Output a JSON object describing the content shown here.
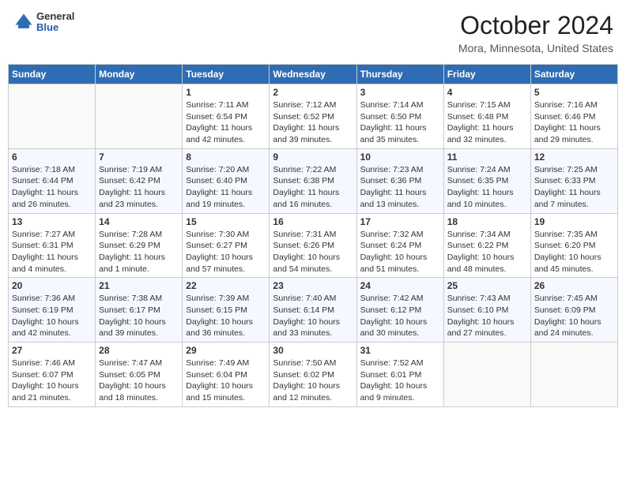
{
  "header": {
    "logo_general": "General",
    "logo_blue": "Blue",
    "month_title": "October 2024",
    "location": "Mora, Minnesota, United States"
  },
  "days_of_week": [
    "Sunday",
    "Monday",
    "Tuesday",
    "Wednesday",
    "Thursday",
    "Friday",
    "Saturday"
  ],
  "weeks": [
    [
      {
        "day": "",
        "info": ""
      },
      {
        "day": "",
        "info": ""
      },
      {
        "day": "1",
        "info": "Sunrise: 7:11 AM\nSunset: 6:54 PM\nDaylight: 11 hours and 42 minutes."
      },
      {
        "day": "2",
        "info": "Sunrise: 7:12 AM\nSunset: 6:52 PM\nDaylight: 11 hours and 39 minutes."
      },
      {
        "day": "3",
        "info": "Sunrise: 7:14 AM\nSunset: 6:50 PM\nDaylight: 11 hours and 35 minutes."
      },
      {
        "day": "4",
        "info": "Sunrise: 7:15 AM\nSunset: 6:48 PM\nDaylight: 11 hours and 32 minutes."
      },
      {
        "day": "5",
        "info": "Sunrise: 7:16 AM\nSunset: 6:46 PM\nDaylight: 11 hours and 29 minutes."
      }
    ],
    [
      {
        "day": "6",
        "info": "Sunrise: 7:18 AM\nSunset: 6:44 PM\nDaylight: 11 hours and 26 minutes."
      },
      {
        "day": "7",
        "info": "Sunrise: 7:19 AM\nSunset: 6:42 PM\nDaylight: 11 hours and 23 minutes."
      },
      {
        "day": "8",
        "info": "Sunrise: 7:20 AM\nSunset: 6:40 PM\nDaylight: 11 hours and 19 minutes."
      },
      {
        "day": "9",
        "info": "Sunrise: 7:22 AM\nSunset: 6:38 PM\nDaylight: 11 hours and 16 minutes."
      },
      {
        "day": "10",
        "info": "Sunrise: 7:23 AM\nSunset: 6:36 PM\nDaylight: 11 hours and 13 minutes."
      },
      {
        "day": "11",
        "info": "Sunrise: 7:24 AM\nSunset: 6:35 PM\nDaylight: 11 hours and 10 minutes."
      },
      {
        "day": "12",
        "info": "Sunrise: 7:25 AM\nSunset: 6:33 PM\nDaylight: 11 hours and 7 minutes."
      }
    ],
    [
      {
        "day": "13",
        "info": "Sunrise: 7:27 AM\nSunset: 6:31 PM\nDaylight: 11 hours and 4 minutes."
      },
      {
        "day": "14",
        "info": "Sunrise: 7:28 AM\nSunset: 6:29 PM\nDaylight: 11 hours and 1 minute."
      },
      {
        "day": "15",
        "info": "Sunrise: 7:30 AM\nSunset: 6:27 PM\nDaylight: 10 hours and 57 minutes."
      },
      {
        "day": "16",
        "info": "Sunrise: 7:31 AM\nSunset: 6:26 PM\nDaylight: 10 hours and 54 minutes."
      },
      {
        "day": "17",
        "info": "Sunrise: 7:32 AM\nSunset: 6:24 PM\nDaylight: 10 hours and 51 minutes."
      },
      {
        "day": "18",
        "info": "Sunrise: 7:34 AM\nSunset: 6:22 PM\nDaylight: 10 hours and 48 minutes."
      },
      {
        "day": "19",
        "info": "Sunrise: 7:35 AM\nSunset: 6:20 PM\nDaylight: 10 hours and 45 minutes."
      }
    ],
    [
      {
        "day": "20",
        "info": "Sunrise: 7:36 AM\nSunset: 6:19 PM\nDaylight: 10 hours and 42 minutes."
      },
      {
        "day": "21",
        "info": "Sunrise: 7:38 AM\nSunset: 6:17 PM\nDaylight: 10 hours and 39 minutes."
      },
      {
        "day": "22",
        "info": "Sunrise: 7:39 AM\nSunset: 6:15 PM\nDaylight: 10 hours and 36 minutes."
      },
      {
        "day": "23",
        "info": "Sunrise: 7:40 AM\nSunset: 6:14 PM\nDaylight: 10 hours and 33 minutes."
      },
      {
        "day": "24",
        "info": "Sunrise: 7:42 AM\nSunset: 6:12 PM\nDaylight: 10 hours and 30 minutes."
      },
      {
        "day": "25",
        "info": "Sunrise: 7:43 AM\nSunset: 6:10 PM\nDaylight: 10 hours and 27 minutes."
      },
      {
        "day": "26",
        "info": "Sunrise: 7:45 AM\nSunset: 6:09 PM\nDaylight: 10 hours and 24 minutes."
      }
    ],
    [
      {
        "day": "27",
        "info": "Sunrise: 7:46 AM\nSunset: 6:07 PM\nDaylight: 10 hours and 21 minutes."
      },
      {
        "day": "28",
        "info": "Sunrise: 7:47 AM\nSunset: 6:05 PM\nDaylight: 10 hours and 18 minutes."
      },
      {
        "day": "29",
        "info": "Sunrise: 7:49 AM\nSunset: 6:04 PM\nDaylight: 10 hours and 15 minutes."
      },
      {
        "day": "30",
        "info": "Sunrise: 7:50 AM\nSunset: 6:02 PM\nDaylight: 10 hours and 12 minutes."
      },
      {
        "day": "31",
        "info": "Sunrise: 7:52 AM\nSunset: 6:01 PM\nDaylight: 10 hours and 9 minutes."
      },
      {
        "day": "",
        "info": ""
      },
      {
        "day": "",
        "info": ""
      }
    ]
  ]
}
